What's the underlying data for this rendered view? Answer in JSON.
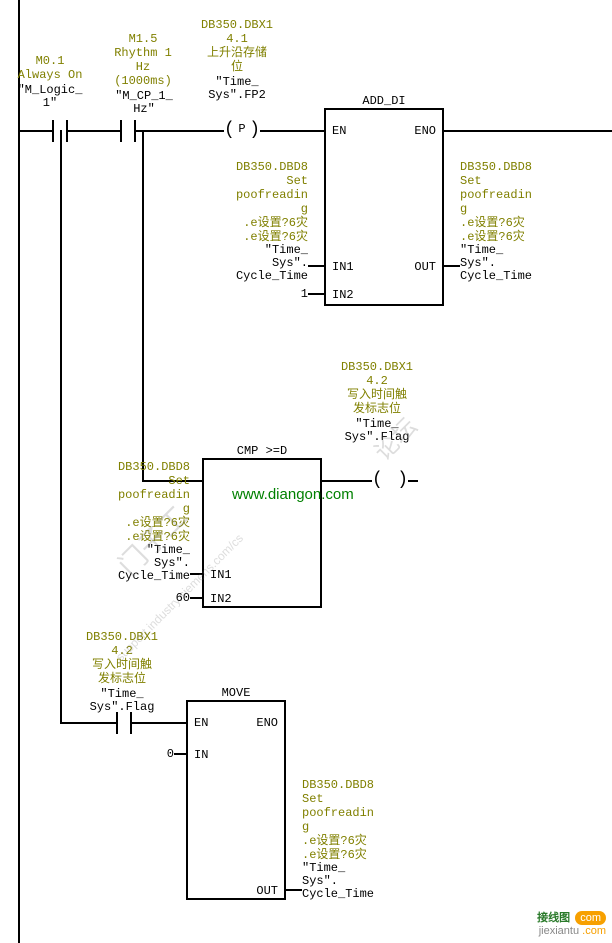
{
  "rail1": {
    "contact1": {
      "addr": "M0.1",
      "desc": "Always On",
      "sym": "\"M_Logic_1\""
    },
    "contact2": {
      "addr": "M1.5",
      "desc1": "Rhythm 1 Hz",
      "desc2": "(1000ms)",
      "sym": "\"M_CP_1_Hz\""
    },
    "coil_p": {
      "addr": "DB350.DBX1",
      "addr2": "4.1",
      "desc": "上升沿存储位",
      "sym": "\"Time_Sys\".FP2",
      "letter": "P"
    },
    "add_di": {
      "title": "ADD_DI",
      "en": "EN",
      "eno": "ENO",
      "in1": "IN1",
      "in2": "IN2",
      "out": "OUT",
      "in1_val": {
        "addr": "DB350.DBD8",
        "l1": "Set",
        "l2": "poofreadin",
        "l3": "g",
        "l4": ".e设置?6灾",
        "l5": ".e设置?6灾",
        "sym1": "\"Time_",
        "sym2": "Sys\".",
        "sym3": "Cycle_Time"
      },
      "in2_val": "1",
      "out_val": {
        "addr": "DB350.DBD8",
        "l1": "Set",
        "l2": "poofreadin",
        "l3": "g",
        "l4": ".e设置?6灾",
        "l5": ".e设置?6灾",
        "sym1": "\"Time_",
        "sym2": "Sys\".",
        "sym3": "Cycle_Time"
      }
    }
  },
  "rail2": {
    "cmp": {
      "title": "CMP >=D",
      "in1": "IN1",
      "in2": "IN2",
      "in2_val": "60",
      "in1_val": {
        "addr": "DB350.DBD8",
        "l1": "Set",
        "l2": "poofreadin",
        "l3": "g",
        "l4": ".e设置?6灾",
        "l5": ".e设置?6灾",
        "sym1": "\"Time_",
        "sym2": "Sys\".",
        "sym3": "Cycle_Time"
      }
    },
    "coil_out": {
      "addr": "DB350.DBX1",
      "addr2": "4.2",
      "desc": "写入时间触发标志位",
      "sym": "\"Time_Sys\".Flag"
    }
  },
  "rail3": {
    "contact": {
      "addr": "DB350.DBX1",
      "addr2": "4.2",
      "desc": "写入时间触发标志位",
      "sym1": "\"Time_",
      "sym2": "Sys\".Flag"
    },
    "move": {
      "title": "MOVE",
      "en": "EN",
      "eno": "ENO",
      "in": "IN",
      "out": "OUT",
      "in_val": "0",
      "out_val": {
        "addr": "DB350.DBD8",
        "l1": "Set",
        "l2": "poofreadin",
        "l3": "g",
        "l4": ".e设置?6灾",
        "l5": ".e设置?6灾",
        "sym1": "\"Time_",
        "sym2": "Sys\".",
        "sym3": "Cycle_Time"
      }
    }
  },
  "watermark": {
    "url": "www.diangon.com",
    "wm2": "门子工",
    "wm3": "support.industry.siemens.com/cs",
    "wm4": "论坛"
  },
  "footer": {
    "l1": "接线图",
    "l2": "jiexiantu"
  }
}
